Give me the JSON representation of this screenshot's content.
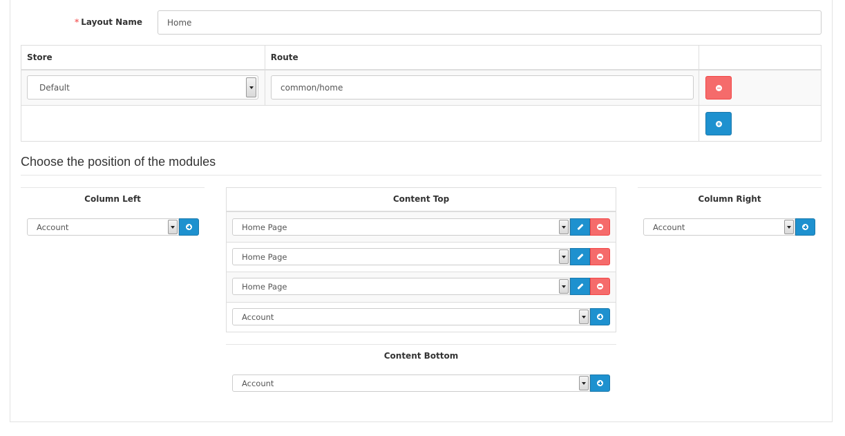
{
  "layout_name": {
    "required_mark": "*",
    "label": "Layout Name",
    "value": "Home"
  },
  "route_table": {
    "headers": [
      "Store",
      "Route",
      ""
    ],
    "rows": [
      {
        "store": "Default",
        "route": "common/home"
      }
    ]
  },
  "modules_section": {
    "title": "Choose the position of the modules"
  },
  "column_left": {
    "title": "Column Left",
    "add_select": "Account"
  },
  "content_top": {
    "title": "Content Top",
    "modules": [
      "Home Page",
      "Home Page",
      "Home Page"
    ],
    "add_select": "Account"
  },
  "column_right": {
    "title": "Column Right",
    "add_select": "Account"
  },
  "content_bottom": {
    "title": "Content Bottom",
    "add_select": "Account"
  },
  "icons": {
    "remove": "minus-circle-icon",
    "add": "plus-circle-icon",
    "edit": "pencil-icon",
    "dropdown": "caret-down-icon"
  },
  "colors": {
    "primary": "#1e91cf",
    "danger": "#f56b6b",
    "border": "#dddddd"
  }
}
